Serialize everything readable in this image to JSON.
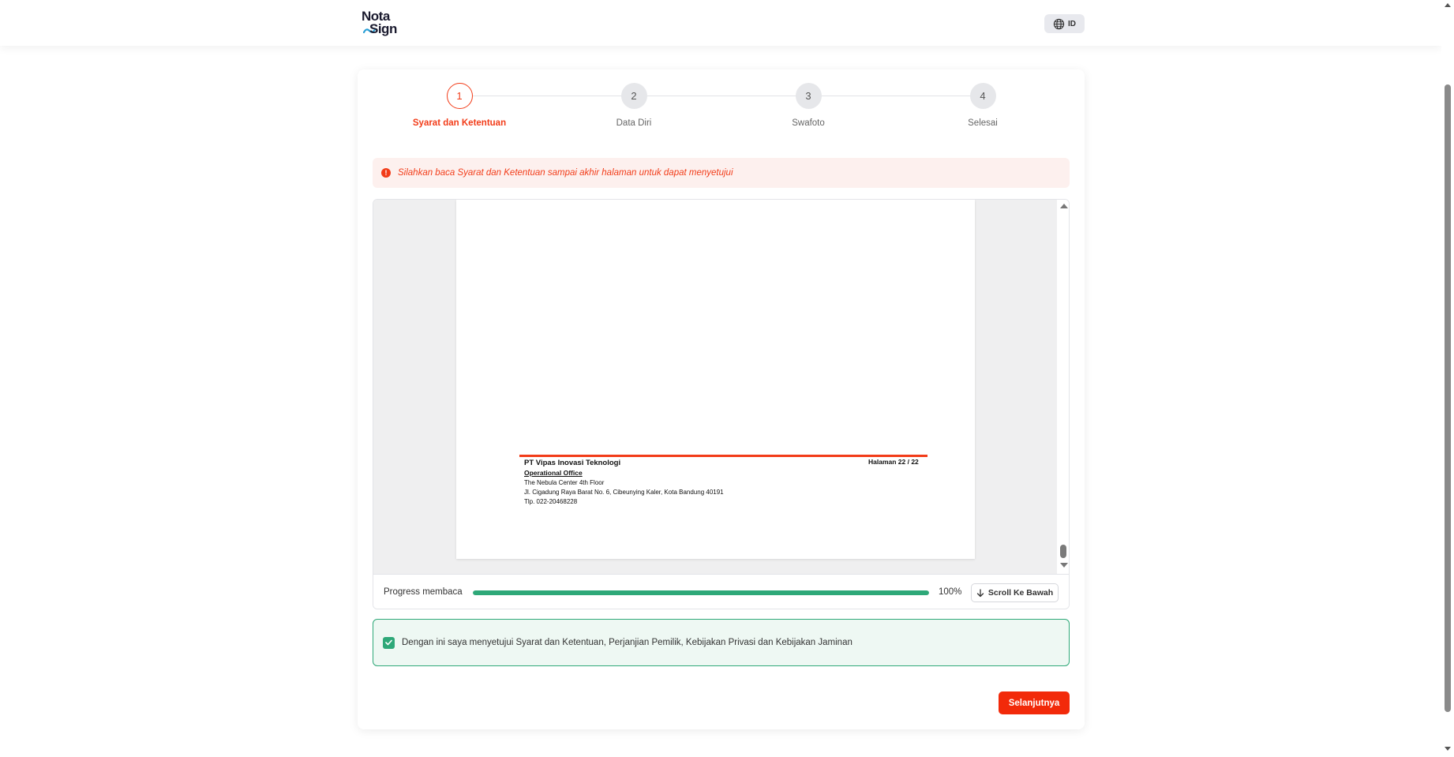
{
  "header": {
    "logo_top": "Nota",
    "logo_bottom": "Sign",
    "lang_label": "ID",
    "lang_icon": "globe-icon"
  },
  "stepper": {
    "steps": [
      {
        "number": "1",
        "label": "Syarat dan Ketentuan",
        "active": true
      },
      {
        "number": "2",
        "label": "Data Diri",
        "active": false
      },
      {
        "number": "3",
        "label": "Swafoto",
        "active": false
      },
      {
        "number": "4",
        "label": "Selesai",
        "active": false
      }
    ]
  },
  "alert": {
    "icon": "info-icon",
    "text": "Silahkan baca Syarat dan Ketentuan sampai akhir halaman untuk dapat menyetujui"
  },
  "document": {
    "company": "PT Vipas Inovasi Teknologi",
    "office_label": "Operational Office",
    "address_line1": "The Nebula Center 4th Floor",
    "address_line2": "Jl. Cigadung Raya Barat No. 6, Cibeunying Kaler, Kota Bandung 40191",
    "phone": "Tlp.  022-20468228",
    "page_indicator": "Halaman 22 / 22"
  },
  "progress": {
    "label": "Progress membaca",
    "value": 100,
    "percent_text": "100%",
    "scroll_button_label": "Scroll Ke Bawah"
  },
  "consent": {
    "checked": true,
    "text": "Dengan ini saya menyetujui Syarat dan Ketentuan, Perjanjian Pemilik, Kebijakan Privasi dan Kebijakan Jaminan"
  },
  "actions": {
    "next_label": "Selanjutnya"
  },
  "colors": {
    "accent": "#f23c19",
    "success": "#2ea878"
  }
}
